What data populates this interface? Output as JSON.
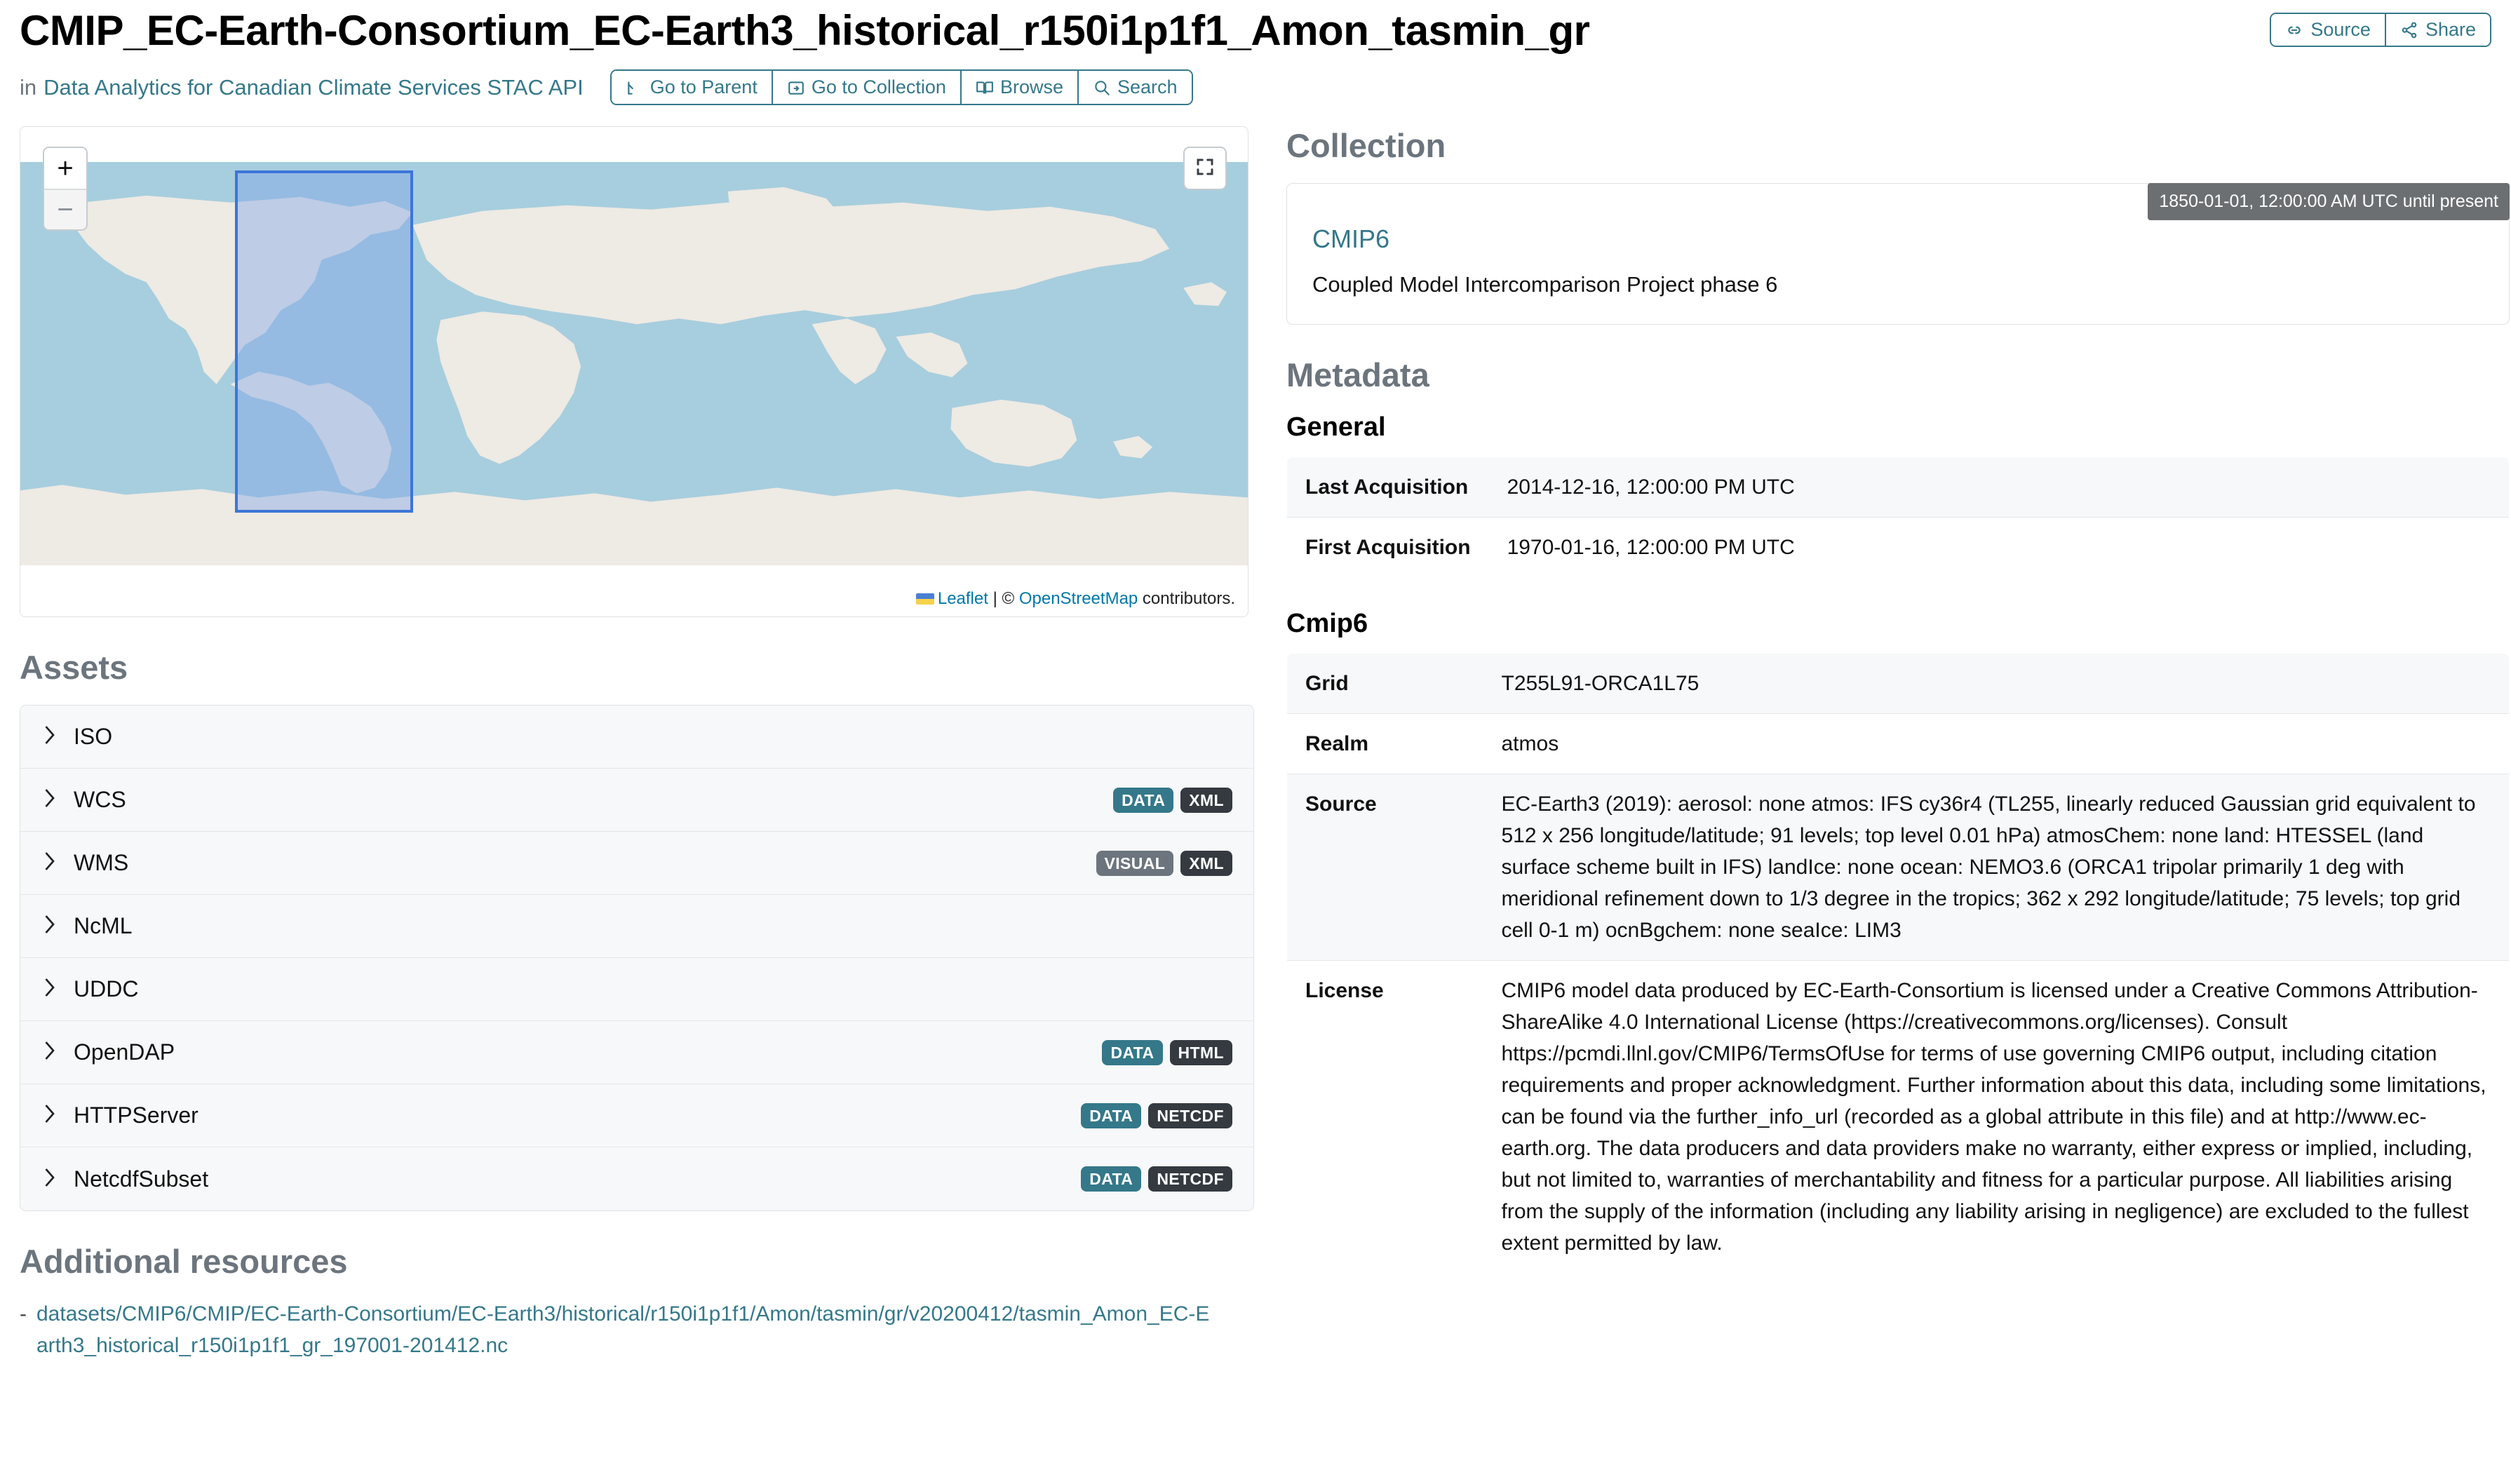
{
  "header": {
    "title": "CMIP_EC-Earth-Consortium_EC-Earth3_historical_r150i1p1f1_Amon_tasmin_gr",
    "in_label": "in",
    "catalog_link": "Data Analytics for Canadian Climate Services STAC API",
    "nav_buttons": [
      {
        "label": "Go to Parent",
        "icon": "arrow-up-left-icon"
      },
      {
        "label": "Go to Collection",
        "icon": "folder-share-icon"
      },
      {
        "label": "Browse",
        "icon": "book-open-icon"
      },
      {
        "label": "Search",
        "icon": "search-icon"
      }
    ],
    "action_buttons": [
      {
        "label": "Source",
        "icon": "link-icon"
      },
      {
        "label": "Share",
        "icon": "share-icon"
      }
    ]
  },
  "map": {
    "zoom_in_label": "+",
    "zoom_out_label": "−",
    "fullscreen_label": "fullscreen",
    "attribution_prefix": "Leaflet",
    "attribution_sep": " | © ",
    "attribution_osm": "OpenStreetMap",
    "attribution_suffix": " contributors.",
    "ocean_color": "#a7cede",
    "land_color": "#eeeae4",
    "bbox_stroke": "#3d75d8",
    "bbox_fill": "rgba(120,160,230,0.45)"
  },
  "assets": {
    "heading": "Assets",
    "rows": [
      {
        "label": "ISO",
        "badges": []
      },
      {
        "label": "WCS",
        "badges": [
          {
            "text": "DATA",
            "style": "data"
          },
          {
            "text": "XML",
            "style": "dark"
          }
        ]
      },
      {
        "label": "WMS",
        "badges": [
          {
            "text": "VISUAL",
            "style": "visual"
          },
          {
            "text": "XML",
            "style": "dark"
          }
        ]
      },
      {
        "label": "NcML",
        "badges": []
      },
      {
        "label": "UDDC",
        "badges": []
      },
      {
        "label": "OpenDAP",
        "badges": [
          {
            "text": "DATA",
            "style": "data"
          },
          {
            "text": "HTML",
            "style": "dark"
          }
        ]
      },
      {
        "label": "HTTPServer",
        "badges": [
          {
            "text": "DATA",
            "style": "data"
          },
          {
            "text": "NETCDF",
            "style": "dark"
          }
        ]
      },
      {
        "label": "NetcdfSubset",
        "badges": [
          {
            "text": "DATA",
            "style": "data"
          },
          {
            "text": "NETCDF",
            "style": "dark"
          }
        ]
      }
    ]
  },
  "additional_resources": {
    "heading": "Additional resources",
    "items": [
      {
        "bullet": "-",
        "text": "datasets/CMIP6/CMIP/EC-Earth-Consortium/EC-Earth3/historical/r150i1p1f1/Amon/tasmin/gr/v20200412/tasmin_Amon_EC-Earth3_historical_r150i1p1f1_gr_197001-201412.nc"
      }
    ]
  },
  "collection": {
    "heading": "Collection",
    "tooltip": "1850-01-01, 12:00:00 AM UTC until present",
    "link": "CMIP6",
    "description": "Coupled Model Intercomparison Project phase 6"
  },
  "metadata": {
    "heading": "Metadata",
    "general": {
      "subheading": "General",
      "rows": [
        {
          "key": "Last Acquisition",
          "value": "2014-12-16, 12:00:00 PM UTC"
        },
        {
          "key": "First Acquisition",
          "value": "1970-01-16, 12:00:00 PM UTC"
        }
      ]
    },
    "cmip6": {
      "subheading": "Cmip6",
      "rows": [
        {
          "key": "Grid",
          "value": "T255L91-ORCA1L75"
        },
        {
          "key": "Realm",
          "value": "atmos"
        },
        {
          "key": "Source",
          "value": "EC-Earth3 (2019): aerosol: none atmos: IFS cy36r4 (TL255, linearly reduced Gaussian grid equivalent to 512 x 256 longitude/latitude; 91 levels; top level 0.01 hPa) atmosChem: none land: HTESSEL (land surface scheme built in IFS) landIce: none ocean: NEMO3.6 (ORCA1 tripolar primarily 1 deg with meridional refinement down to 1/3 degree in the tropics; 362 x 292 longitude/latitude; 75 levels; top grid cell 0-1 m) ocnBgchem: none seaIce: LIM3"
        },
        {
          "key": "License",
          "value": "CMIP6 model data produced by EC-Earth-Consortium is licensed under a Creative Commons Attribution-ShareAlike 4.0 International License (https://creativecommons.org/licenses). Consult https://pcmdi.llnl.gov/CMIP6/TermsOfUse for terms of use governing CMIP6 output, including citation requirements and proper acknowledgment. Further information about this data, including some limitations, can be found via the further_info_url (recorded as a global attribute in this file) and at http://www.ec-earth.org. The data producers and data providers make no warranty, either express or implied, including, but not limited to, warranties of merchantability and fitness for a particular purpose. All liabilities arising from the supply of the information (including any liability arising in negligence) are excluded to the fullest extent permitted by law."
        }
      ]
    }
  }
}
